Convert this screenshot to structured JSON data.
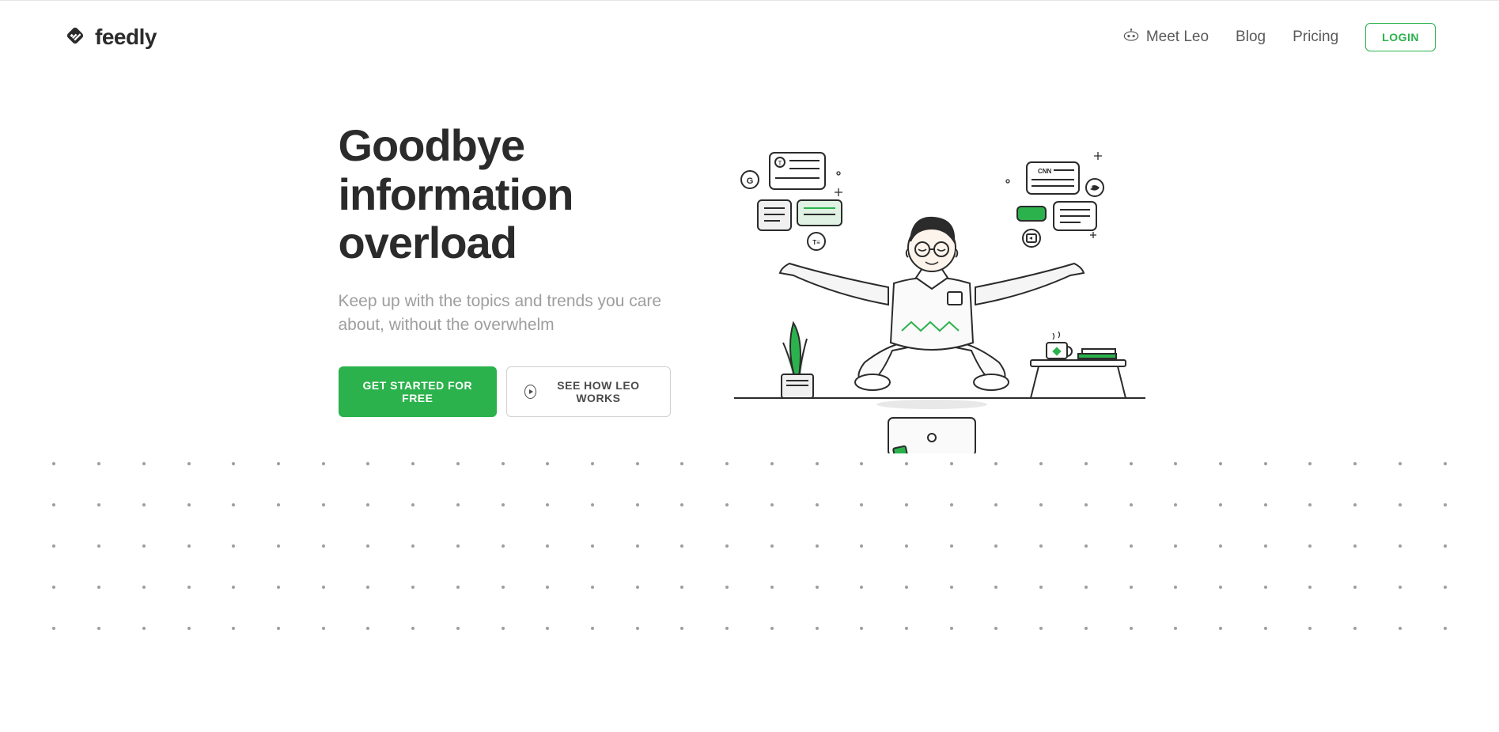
{
  "header": {
    "brand": "feedly",
    "nav": {
      "meet_leo": "Meet Leo",
      "blog": "Blog",
      "pricing": "Pricing",
      "login": "LOGIN"
    }
  },
  "hero": {
    "title": "Goodbye information overload",
    "subtitle": "Keep up with the topics and trends you care about, without the overwhelm",
    "cta_primary": "GET STARTED FOR FREE",
    "cta_secondary": "SEE HOW LEO WORKS"
  },
  "colors": {
    "accent": "#2bb24c",
    "text_dark": "#2b2b2b",
    "text_muted": "#9e9e9e"
  },
  "icons": {
    "logo": "feedly-logo",
    "leo": "robot-face-icon",
    "play": "play-circle-icon"
  }
}
